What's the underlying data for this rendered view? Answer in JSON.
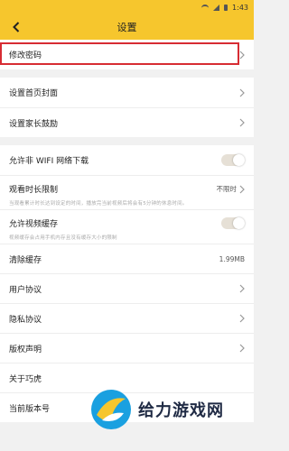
{
  "status": {
    "time": "1:43",
    "wifi_icon": "wifi-icon",
    "signal_icon": "signal-icon",
    "battery_icon": "battery-icon"
  },
  "header": {
    "title": "设置",
    "back_icon": "chevron-left-icon"
  },
  "groups": [
    {
      "items": [
        {
          "label": "修改密码",
          "highlighted": true
        }
      ]
    },
    {
      "items": [
        {
          "label": "设置首页封面"
        },
        {
          "label": "设置家长鼓励"
        }
      ]
    },
    {
      "items": [
        {
          "label": "允许非 WIFI 网络下载",
          "toggle": true
        },
        {
          "label": "观看时长限制",
          "value": "不限时",
          "sub": "当观看累计时长达到设定的时间，播放完当前视频后将会有5分钟的休息时间。"
        },
        {
          "label": "允许视频缓存",
          "toggle": true,
          "sub": "视频缓存会占用手机内存且没有缓存大小的限制"
        },
        {
          "label": "清除缓存",
          "value": "1.99MB"
        },
        {
          "label": "用户协议"
        },
        {
          "label": "隐私协议"
        },
        {
          "label": "版权声明"
        },
        {
          "label": "关于巧虎"
        },
        {
          "label": "当前版本号"
        }
      ]
    }
  ],
  "watermark": {
    "text": "给力游戏网"
  },
  "colors": {
    "accent": "#f6c62d",
    "highlight": "#d72c33"
  }
}
